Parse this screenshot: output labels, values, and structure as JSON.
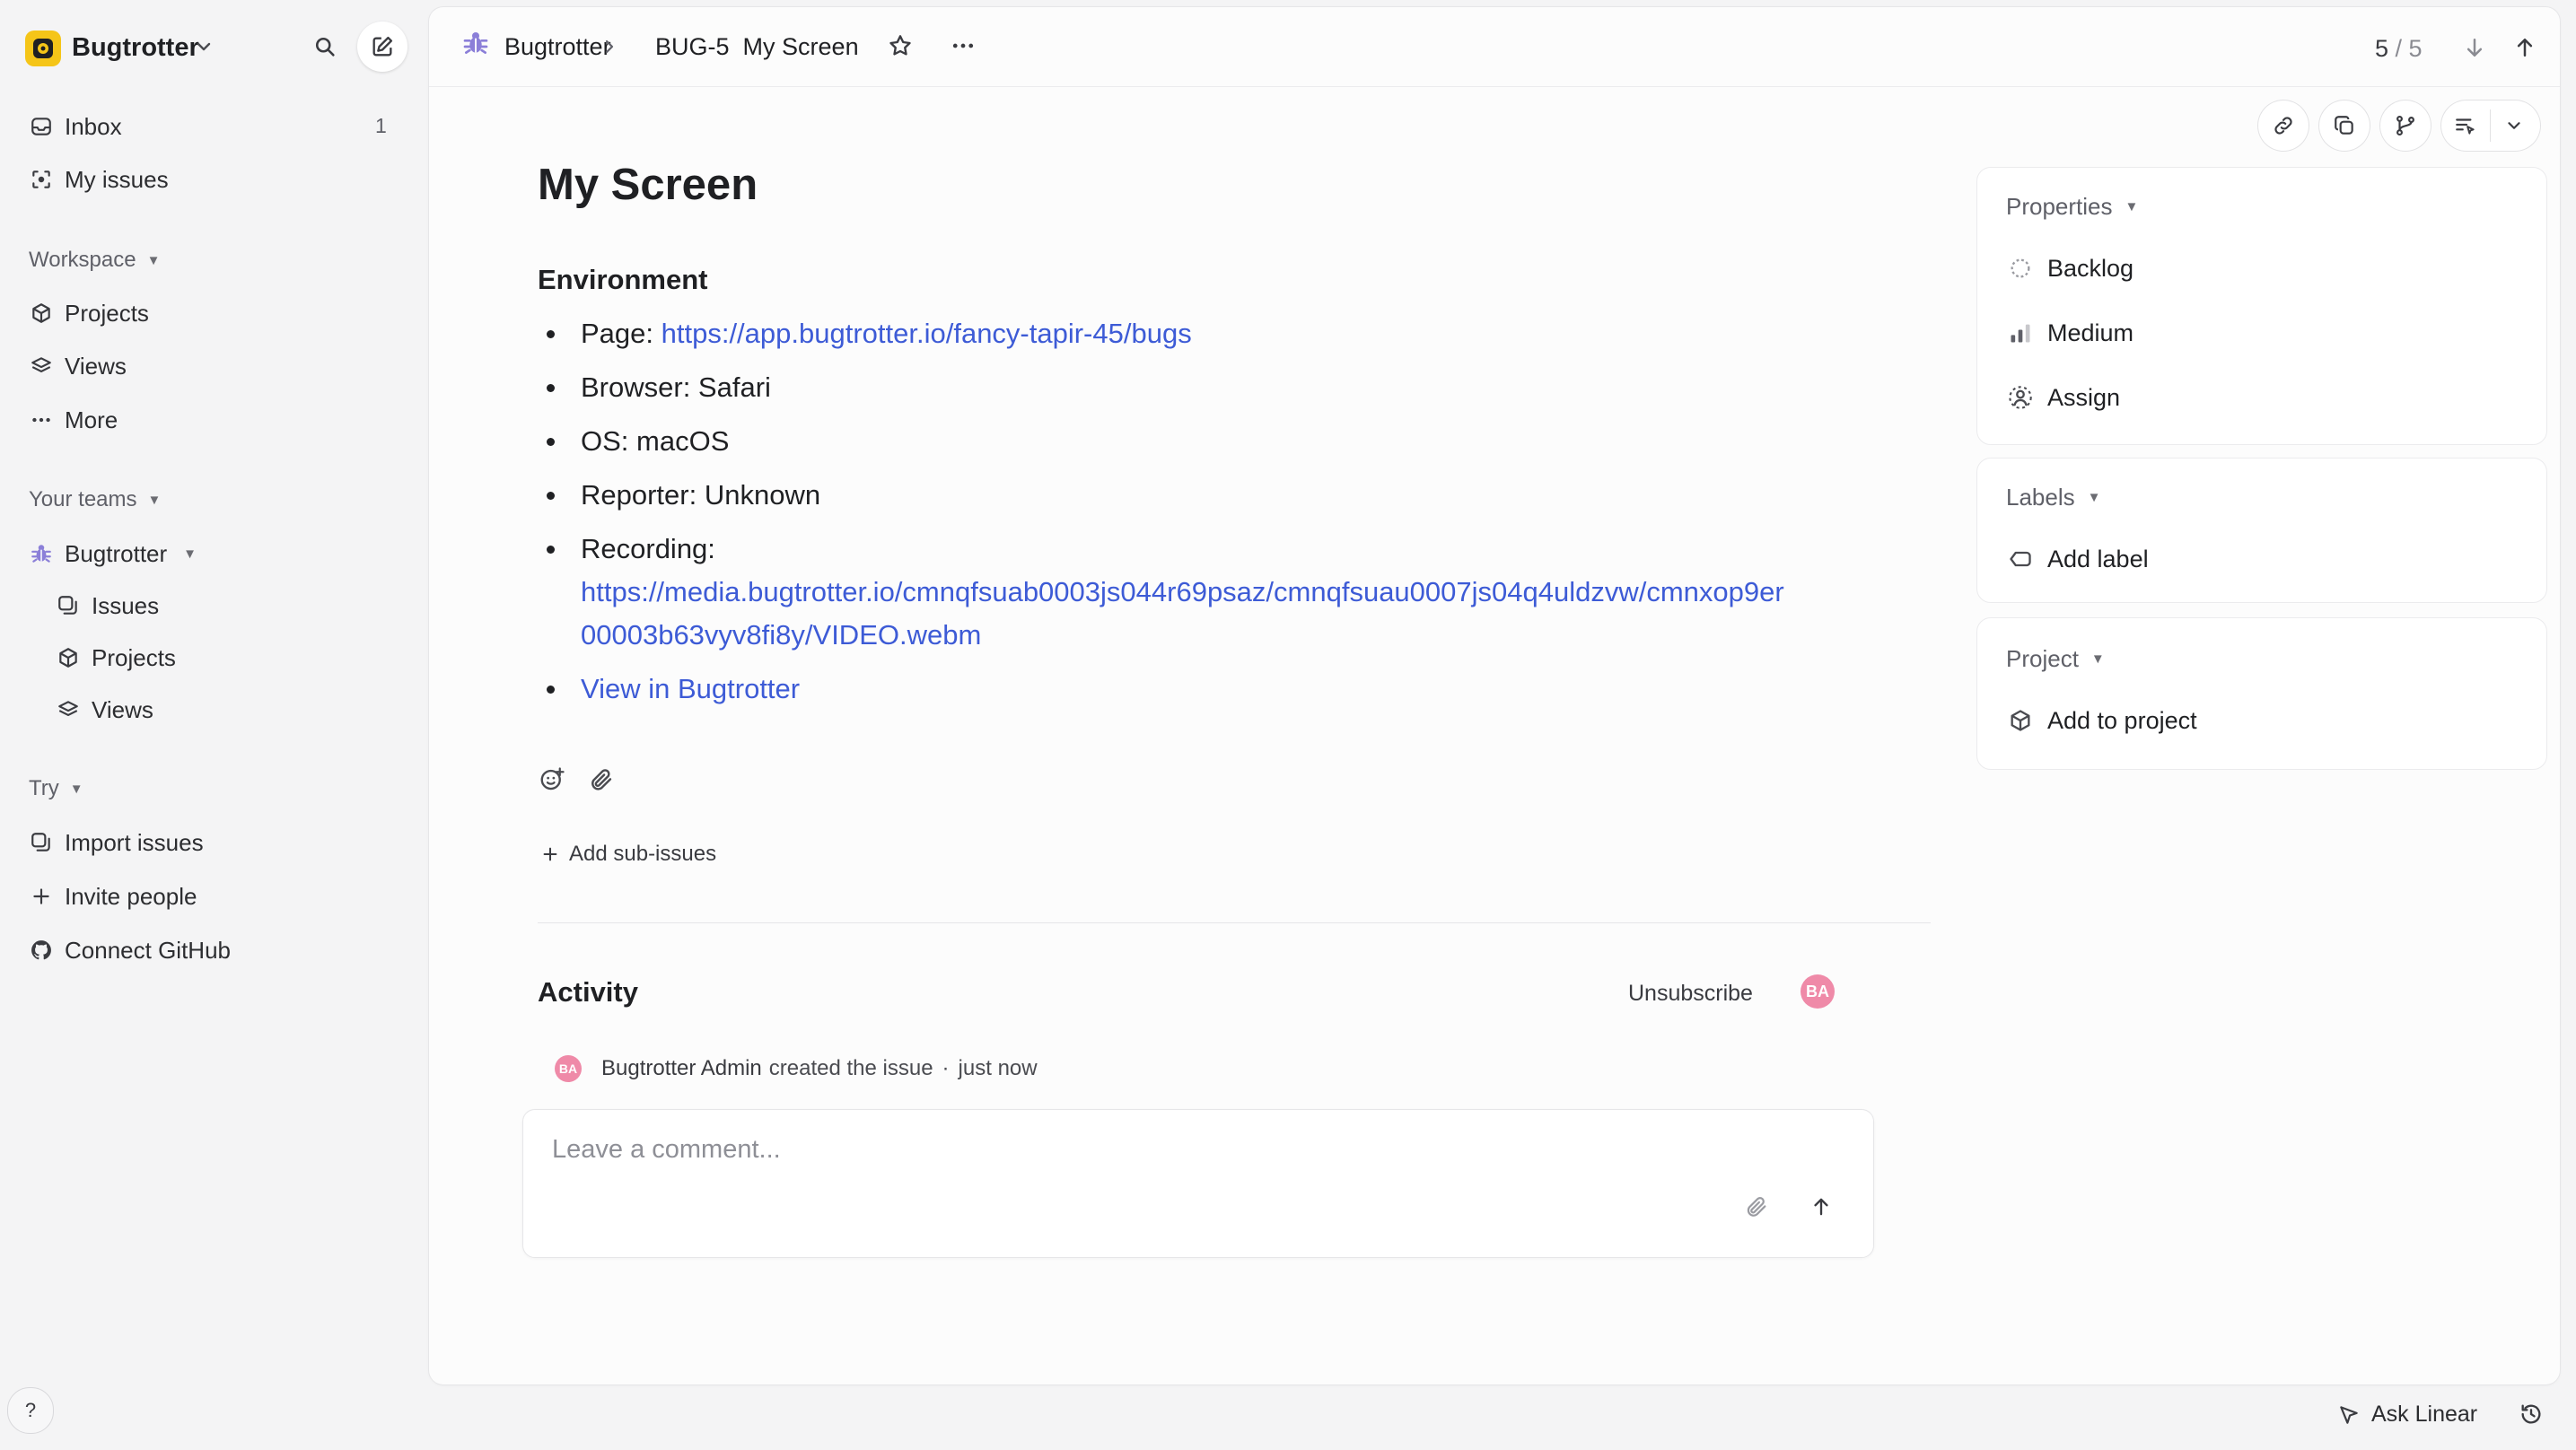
{
  "workspace": {
    "name": "Bugtrotter"
  },
  "sidebar": {
    "inbox": {
      "label": "Inbox",
      "count": "1"
    },
    "my_issues": "My issues",
    "workspace_section": "Workspace",
    "projects": "Projects",
    "views": "Views",
    "more": "More",
    "teams_section": "Your teams",
    "team_name": "Bugtrotter",
    "team_issues": "Issues",
    "team_projects": "Projects",
    "team_views": "Views",
    "try_section": "Try",
    "import_issues": "Import issues",
    "invite_people": "Invite people",
    "connect_github": "Connect GitHub",
    "help": "?"
  },
  "breadcrumb": {
    "team": "Bugtrotter",
    "issue_id": "BUG-5",
    "issue_title": "My Screen",
    "pager": "5 / 5",
    "pager_current": "5",
    "pager_total": "5"
  },
  "issue": {
    "title": "My Screen",
    "section_heading": "Environment",
    "page_label": "Page: ",
    "page_url": "https://app.bugtrotter.io/fancy-tapir-45/bugs",
    "browser": "Browser: Safari",
    "os": "OS: macOS",
    "reporter": "Reporter: Unknown",
    "recording_label": "Recording:",
    "recording_url_line1": "https://media.bugtrotter.io/cmnqfsuab0003js044r69psaz/cmnqfsuau0007js04q4uldzvw/cmnxop9er",
    "recording_url_line2": "00003b63vyv8fi8y/VIDEO.webm",
    "view_link": "View in Bugtrotter",
    "add_sub_issues": "Add sub-issues"
  },
  "activity": {
    "heading": "Activity",
    "unsubscribe": "Unsubscribe",
    "avatar_initials": "BA",
    "entry_author": "Bugtrotter Admin",
    "entry_action": "created the issue",
    "entry_sep": "·",
    "entry_time": "just now",
    "comment_placeholder": "Leave a comment..."
  },
  "properties": {
    "heading": "Properties",
    "status": "Backlog",
    "priority": "Medium",
    "assignee": "Assign",
    "labels_heading": "Labels",
    "add_label": "Add label",
    "project_heading": "Project",
    "add_to_project": "Add to project"
  },
  "footer": {
    "ask": "Ask Linear"
  },
  "colors": {
    "link": "#3d5bd6",
    "avatar": "#ef8aa8",
    "brand": "#f5c518",
    "team_icon": "#8b7fd8"
  }
}
